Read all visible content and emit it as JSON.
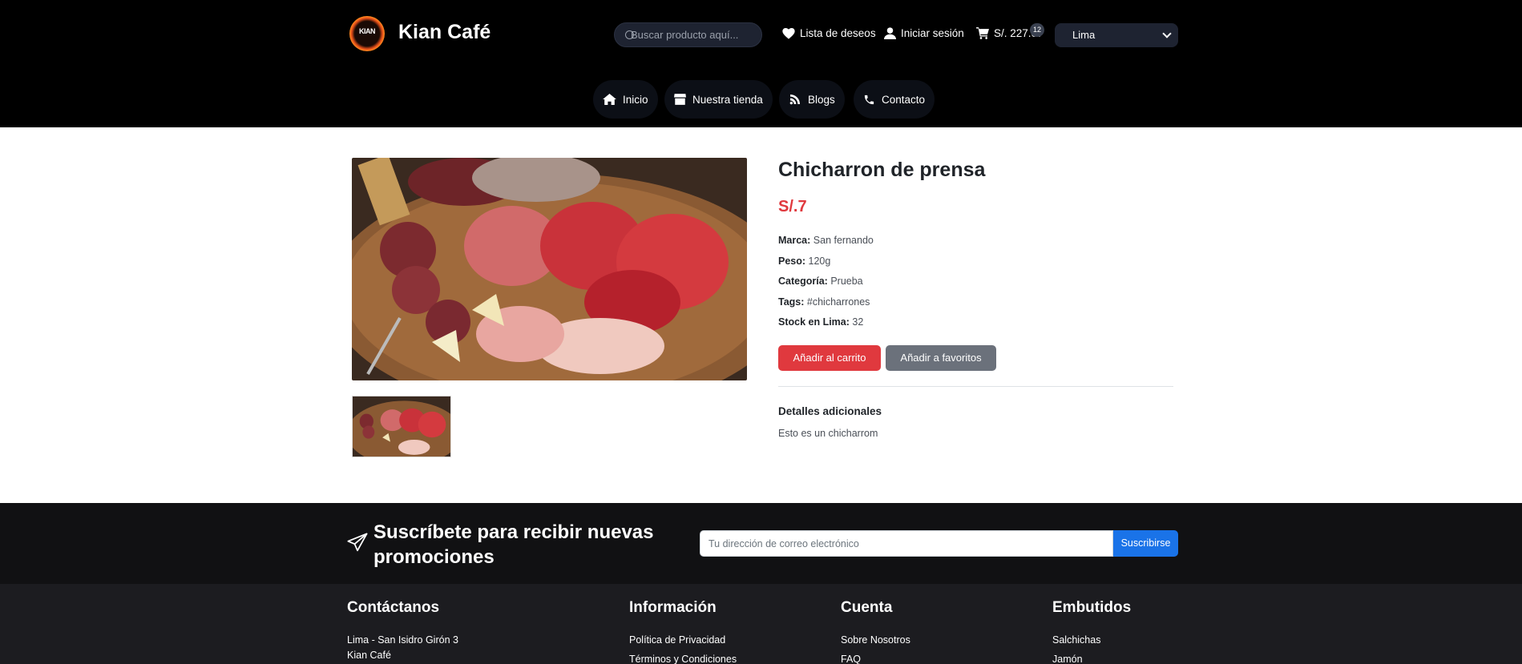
{
  "header": {
    "brand": "Kian Café",
    "logo_text": "KIAN",
    "search_placeholder": "Buscar producto aquí...",
    "wishlist_label": "Lista de deseos",
    "login_label": "Iniciar sesión",
    "cart_total": "S/. 227.07",
    "cart_count": "12",
    "city": "Lima"
  },
  "nav": {
    "items": [
      {
        "label": "Inicio",
        "icon": "home-icon"
      },
      {
        "label": "Nuestra tienda",
        "icon": "store-icon"
      },
      {
        "label": "Blogs",
        "icon": "blog-icon"
      },
      {
        "label": "Contacto",
        "icon": "phone-icon"
      }
    ]
  },
  "product": {
    "title": "Chicharron de prensa",
    "price": "S/.7",
    "brand_label": "Marca:",
    "brand_value": "San fernando",
    "weight_label": "Peso:",
    "weight_value": "120g",
    "category_label": "Categoría:",
    "category_value": "Prueba",
    "tags_label": "Tags:",
    "tags_value": "#chicharrones",
    "stock_label": "Stock en Lima:",
    "stock_value": "32",
    "add_cart": "Añadir al carrito",
    "add_fav": "Añadir a favoritos",
    "details_title": "Detalles adicionales",
    "details_text": "Esto es un chicharrom"
  },
  "newsletter": {
    "title": "Suscríbete para recibir nuevas promociones",
    "placeholder": "Tu dirección de correo electrónico",
    "button": "Suscribirse"
  },
  "footer": {
    "contact": {
      "title": "Contáctanos",
      "items": [
        "Lima - San Isidro Girón 3",
        "Kian Café"
      ]
    },
    "info": {
      "title": "Información",
      "items": [
        "Política de Privacidad",
        "Términos y Condiciones"
      ]
    },
    "account": {
      "title": "Cuenta",
      "items": [
        "Sobre Nosotros",
        "FAQ"
      ]
    },
    "sausages": {
      "title": "Embutidos",
      "items": [
        "Salchichas",
        "Jamón"
      ]
    }
  },
  "colors": {
    "accent_red": "#e0393e",
    "button_gray": "#6b717b",
    "subscribe_blue": "#1a73e8"
  }
}
